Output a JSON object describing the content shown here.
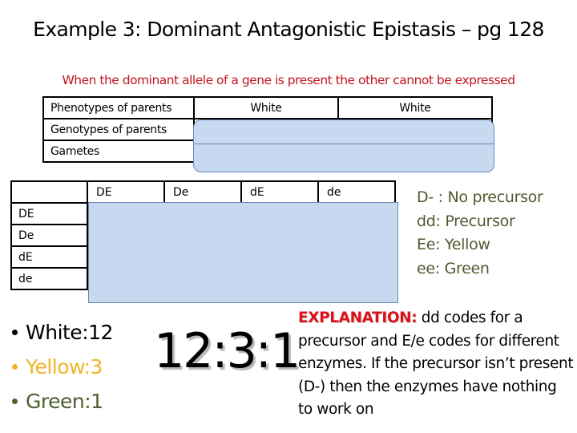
{
  "title": "Example 3: Dominant Antagonistic Epistasis – pg 128",
  "subtitle": {
    "segments": [
      {
        "text": "When the ",
        "color": "#c0161d"
      },
      {
        "text": "dominant",
        "color": "#c0161d"
      },
      {
        "text": " allele ",
        "color": "#c0161d"
      },
      {
        "text": "of",
        "color": "#c0161d"
      },
      {
        "text": " a ",
        "color": "#c0161d"
      },
      {
        "text": "gene",
        "color": "#c0161d"
      },
      {
        "text": " ",
        "color": "#c0161d"
      },
      {
        "text": "is",
        "color": "#c0161d"
      },
      {
        "text": " present the other cannot be expressed",
        "color": "#c0161d"
      }
    ],
    "full_text": "When the dominant allele of a gene is present the other cannot be expressed"
  },
  "parents_table": {
    "rows": [
      {
        "label": "Phenotypes of parents",
        "parent1": "White",
        "parent2": "White"
      },
      {
        "label": "Genotypes of parents",
        "parent1": "",
        "parent2": ""
      },
      {
        "label": "Gametes",
        "parent1": "",
        "parent2": ""
      }
    ],
    "hidden_answer_color": "#c6d9f1"
  },
  "punnett_square": {
    "column_headers": [
      "DE",
      "De",
      "dE",
      "de"
    ],
    "row_headers": [
      "DE",
      "De",
      "dE",
      "de"
    ],
    "hidden_answer_color": "#c6d9f1"
  },
  "key": [
    "D- : No precursor",
    "dd: Precursor",
    "Ee: Yellow",
    "ee: Green"
  ],
  "results": [
    {
      "label": "White:12",
      "color": "#000000"
    },
    {
      "label": "Yellow:3",
      "color": "#f0b428"
    },
    {
      "label": "Green:1",
      "color": "#4f5f2f"
    }
  ],
  "ratio": "12:3:1",
  "explanation": {
    "label": "EXPLANATION:",
    "text": " dd codes for a precursor and E/e codes for different enzymes. If the precursor isn’t present (D-) then the enzymes have nothing to work on"
  }
}
